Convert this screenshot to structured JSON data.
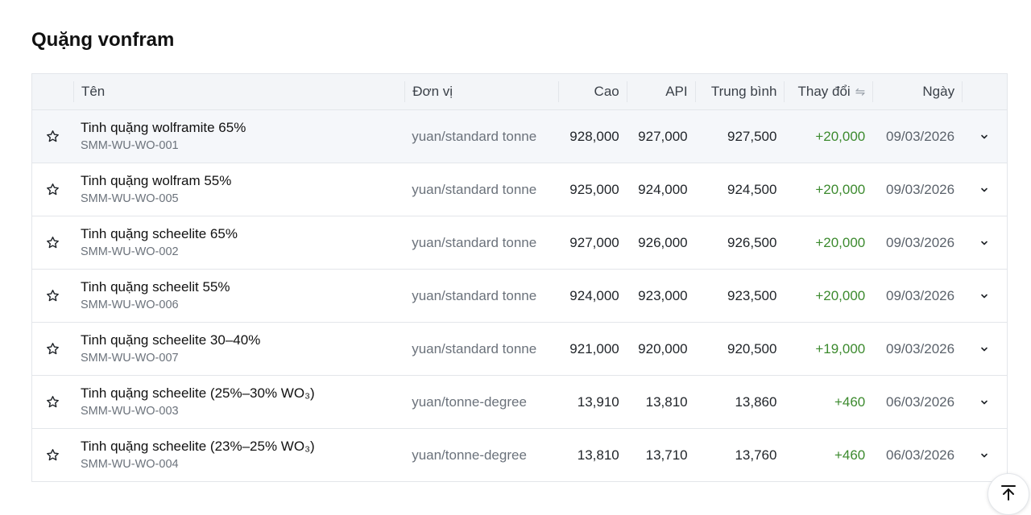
{
  "page": {
    "title": "Quặng vonfram"
  },
  "table": {
    "headers": {
      "name": "Tên",
      "unit": "Đơn vị",
      "high": "Cao",
      "api": "API",
      "avg": "Trung bình",
      "change": "Thay đổi",
      "date": "Ngày"
    },
    "rows": [
      {
        "name": "Tinh quặng wolframite 65%",
        "code": "SMM-WU-WO-001",
        "unit": "yuan/standard tonne",
        "high": "928,000",
        "api": "927,000",
        "avg": "927,500",
        "change": "+20,000",
        "date": "09/03/2026"
      },
      {
        "name": "Tinh quặng wolfram 55%",
        "code": "SMM-WU-WO-005",
        "unit": "yuan/standard tonne",
        "high": "925,000",
        "api": "924,000",
        "avg": "924,500",
        "change": "+20,000",
        "date": "09/03/2026"
      },
      {
        "name": "Tinh quặng scheelite 65%",
        "code": "SMM-WU-WO-002",
        "unit": "yuan/standard tonne",
        "high": "927,000",
        "api": "926,000",
        "avg": "926,500",
        "change": "+20,000",
        "date": "09/03/2026"
      },
      {
        "name": "Tinh quặng scheelit 55%",
        "code": "SMM-WU-WO-006",
        "unit": "yuan/standard tonne",
        "high": "924,000",
        "api": "923,000",
        "avg": "923,500",
        "change": "+20,000",
        "date": "09/03/2026"
      },
      {
        "name": "Tinh quặng scheelite 30–40%",
        "code": "SMM-WU-WO-007",
        "unit": "yuan/standard tonne",
        "high": "921,000",
        "api": "920,000",
        "avg": "920,500",
        "change": "+19,000",
        "date": "09/03/2026"
      },
      {
        "name": "Tinh quặng scheelite (25%–30% WO₃)",
        "code": "SMM-WU-WO-003",
        "unit": "yuan/tonne-degree",
        "high": "13,910",
        "api": "13,810",
        "avg": "13,860",
        "change": "+460",
        "date": "06/03/2026"
      },
      {
        "name": "Tinh quặng scheelite (23%–25% WO₃)",
        "code": "SMM-WU-WO-004",
        "unit": "yuan/tonne-degree",
        "high": "13,810",
        "api": "13,710",
        "avg": "13,760",
        "change": "+460",
        "date": "06/03/2026"
      }
    ]
  },
  "icons": {
    "favorite": "star-outline-icon",
    "expand": "chevron-down-icon",
    "sort": "sort-swap-icon",
    "scroll_top": "arrow-up-to-top-icon"
  },
  "colors": {
    "positive_change": "#3c8a2e",
    "header_bg": "#f3f5f8",
    "border": "#e3e6ea"
  }
}
